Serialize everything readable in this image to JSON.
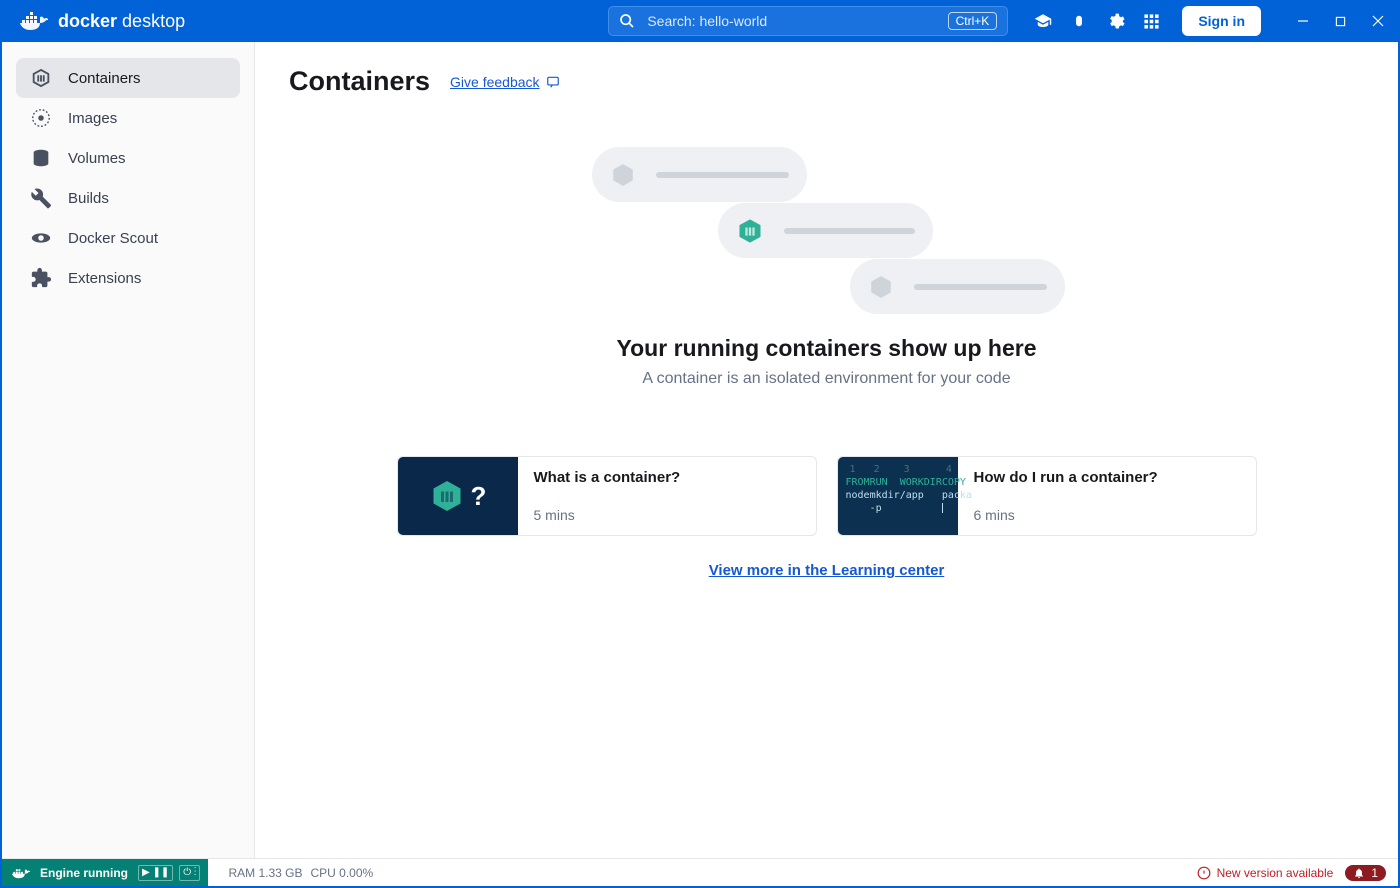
{
  "brand": {
    "bold": "docker",
    "rest": "desktop"
  },
  "search": {
    "placeholder": "Search: hello-world",
    "kbd": "Ctrl+K"
  },
  "titlebar": {
    "signin": "Sign in"
  },
  "sidebar": {
    "items": [
      {
        "label": "Containers",
        "active": true
      },
      {
        "label": "Images"
      },
      {
        "label": "Volumes"
      },
      {
        "label": "Builds"
      },
      {
        "label": "Docker Scout"
      },
      {
        "label": "Extensions"
      }
    ]
  },
  "main": {
    "title": "Containers",
    "feedback": "Give feedback",
    "hero_title": "Your running containers show up here",
    "hero_sub": "A container is an isolated environment for your code",
    "cards": [
      {
        "title": "What is a container?",
        "time": "5 mins"
      },
      {
        "title": "How do I run a container?",
        "time": "6 mins"
      }
    ],
    "learn_more": "View more in the Learning center",
    "dockerfile_lines": [
      {
        "n": "1",
        "kw": "FROM",
        "arg": "node"
      },
      {
        "n": "2",
        "kw": "RUN",
        "arg": "mkdir -p"
      },
      {
        "n": "3",
        "kw": "WORKDIR",
        "arg": "/app"
      },
      {
        "n": "4",
        "kw": "COPY",
        "arg": "packa"
      }
    ]
  },
  "footer": {
    "engine": "Engine running",
    "ram": "RAM 1.33 GB",
    "cpu": "CPU 0.00%",
    "update": "New version available",
    "notif_count": "1"
  }
}
